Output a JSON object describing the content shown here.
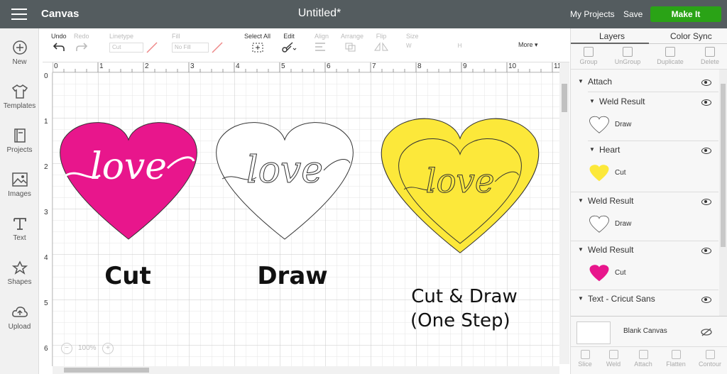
{
  "topbar": {
    "app_title": "Canvas",
    "doc_title": "Untitled*",
    "my_projects": "My Projects",
    "save": "Save",
    "make_it": "Make It"
  },
  "leftbar": {
    "items": [
      {
        "label": "New",
        "icon": "plus-circle-icon"
      },
      {
        "label": "Templates",
        "icon": "shirt-icon"
      },
      {
        "label": "Projects",
        "icon": "book-icon"
      },
      {
        "label": "Images",
        "icon": "image-icon"
      },
      {
        "label": "Text",
        "icon": "text-icon"
      },
      {
        "label": "Shapes",
        "icon": "shapes-icon"
      },
      {
        "label": "Upload",
        "icon": "cloud-upload-icon"
      }
    ]
  },
  "toolbar": {
    "undo": "Undo",
    "redo": "Redo",
    "linetype": "Linetype",
    "linetype_value": "Cut",
    "fill": "Fill",
    "fill_value": "No Fill",
    "select_all": "Select All",
    "edit": "Edit",
    "align": "Align",
    "arrange": "Arrange",
    "flip": "Flip",
    "size": "Size",
    "size_w": "W",
    "size_h": "H",
    "more": "More"
  },
  "canvas": {
    "ruler_h": [
      "0",
      "1",
      "2",
      "3",
      "4",
      "5",
      "6",
      "7",
      "8",
      "9",
      "10",
      "11"
    ],
    "ruler_v": [
      "0",
      "1",
      "2",
      "3",
      "4",
      "5",
      "6"
    ],
    "label_cut": "Cut",
    "label_draw": "Draw",
    "label_cutdraw_1": "Cut & Draw",
    "label_cutdraw_2": "(One Step)",
    "heart_word": "love",
    "zoom": "100%",
    "colors": {
      "pink": "#e8168c",
      "yellow": "#fce83a",
      "grid": "#d9d9d9"
    }
  },
  "rpanel": {
    "tabs": [
      "Layers",
      "Color Sync"
    ],
    "actions": [
      "Group",
      "UnGroup",
      "Duplicate",
      "Delete"
    ],
    "layers": [
      {
        "label": "Attach"
      },
      {
        "label": "Weld Result"
      },
      {
        "label": "Draw"
      },
      {
        "label": "Heart"
      },
      {
        "label": "Cut"
      },
      {
        "label": "Weld Result"
      },
      {
        "label": "Draw"
      },
      {
        "label": "Weld Result"
      },
      {
        "label": "Cut"
      },
      {
        "label": "Text - Cricut Sans"
      }
    ],
    "blank_canvas": "Blank Canvas",
    "bottom_actions": [
      "Slice",
      "Weld",
      "Attach",
      "Flatten",
      "Contour"
    ]
  }
}
